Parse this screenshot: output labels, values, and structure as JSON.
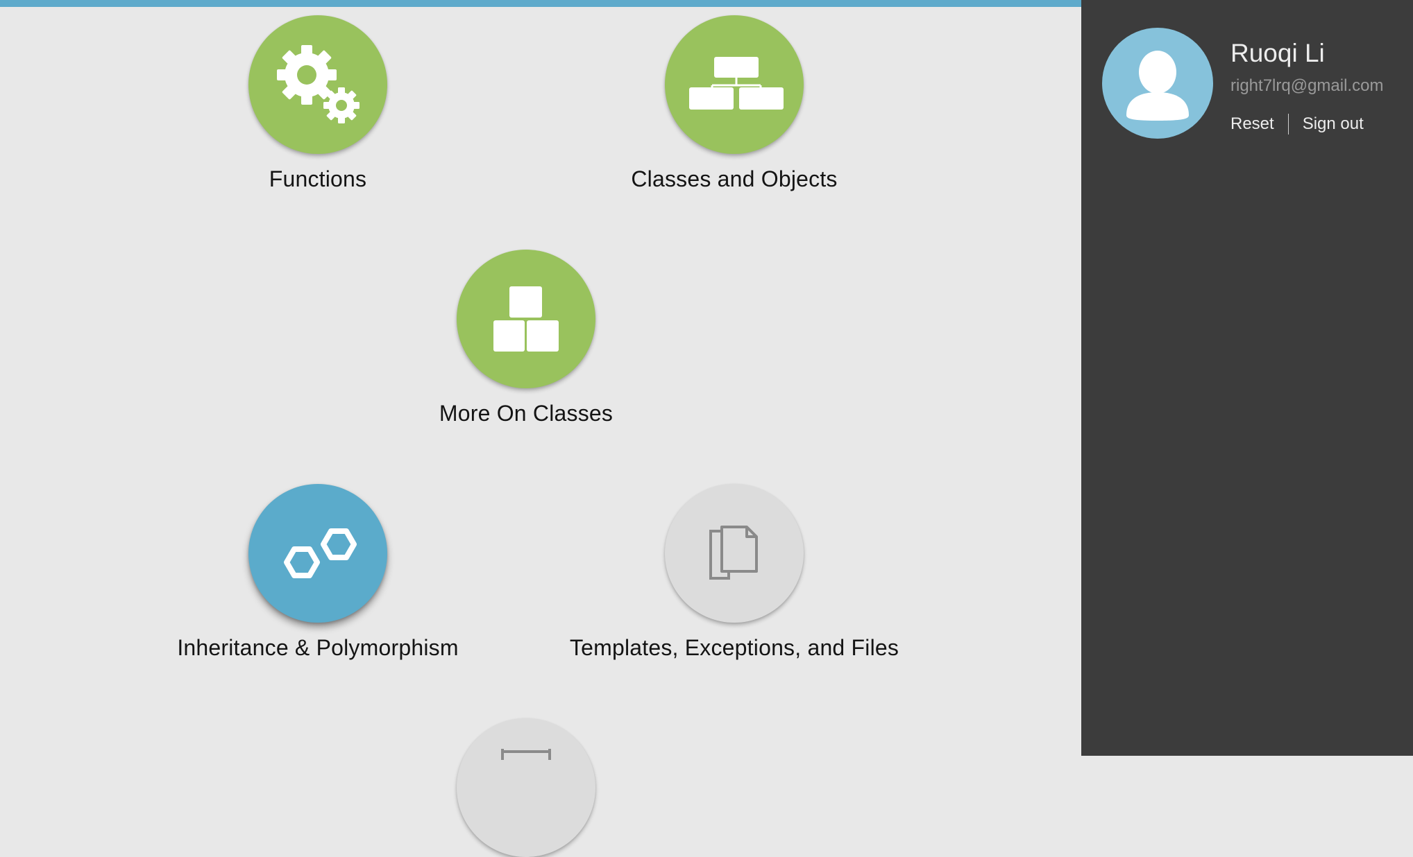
{
  "lessons": [
    {
      "title": "Functions",
      "status": "completed",
      "icon": "gears-icon"
    },
    {
      "title": "Classes and Objects",
      "status": "completed",
      "icon": "hierarchy-icon"
    },
    {
      "title": "More On Classes",
      "status": "completed",
      "icon": "blocks-icon"
    },
    {
      "title": "Inheritance & Polymorphism",
      "status": "current",
      "icon": "hexagons-icon"
    },
    {
      "title": "Templates, Exceptions, and Files",
      "status": "locked",
      "icon": "files-icon"
    },
    {
      "title": "",
      "status": "locked",
      "icon": "container-icon"
    }
  ],
  "user": {
    "name": "Ruoqi Li",
    "email": "right7lrq@gmail.com",
    "reset_label": "Reset",
    "signout_label": "Sign out"
  },
  "colors": {
    "completed": "#99c25d",
    "current": "#5babcb",
    "locked": "#dcdcdc",
    "sidebar": "#3c3c3c",
    "topbar": "#5eaacb"
  }
}
